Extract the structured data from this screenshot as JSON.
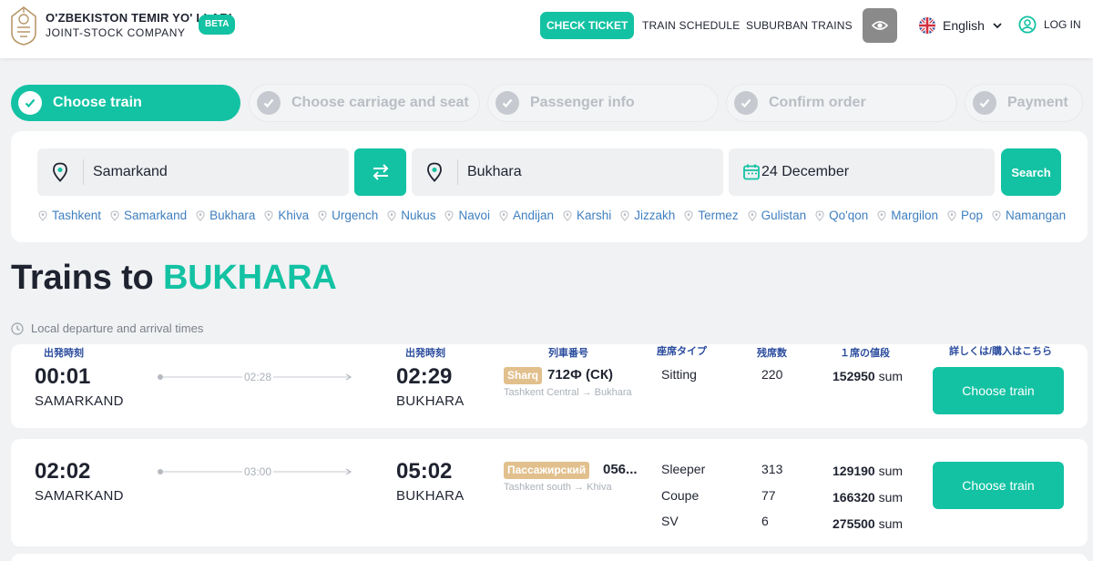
{
  "header": {
    "brand_line1": "O'ZBEKISTON TEMIR YO' LLARI",
    "brand_line2": "JOINT-STOCK COMPANY",
    "beta": "BETA",
    "check_ticket": "CHECK TICKET",
    "train_schedule": "TRAIN SCHEDULE",
    "suburban_trains": "SUBURBAN TRAINS",
    "language": "English",
    "login": "LOG IN"
  },
  "steps": [
    {
      "label": "Choose train",
      "active": true
    },
    {
      "label": "Choose carriage and seat",
      "active": false
    },
    {
      "label": "Passenger info",
      "active": false
    },
    {
      "label": "Confirm order",
      "active": false
    },
    {
      "label": "Payment",
      "active": false
    }
  ],
  "search": {
    "from": "Samarkand",
    "to": "Bukhara",
    "date": "24 December",
    "search_label": "Search",
    "cities": [
      "Tashkent",
      "Samarkand",
      "Bukhara",
      "Khiva",
      "Urgench",
      "Nukus",
      "Navoi",
      "Andijan",
      "Karshi",
      "Jizzakh",
      "Termez",
      "Gulistan",
      "Qo'qon",
      "Margilon",
      "Pop",
      "Namangan"
    ]
  },
  "title": {
    "prefix": "Trains to",
    "destination": "BUKHARA"
  },
  "timezone_note": "Local departure and arrival times",
  "column_labels": {
    "departure": "出発時刻",
    "arrival": "出発時刻",
    "train_number": "列車番号",
    "seat_type": "座席タイプ",
    "seats_left": "残席数",
    "price_per_seat": "１席の値段",
    "details": "詳しくは/購入はこちら"
  },
  "trains": [
    {
      "departure_time": "00:01",
      "departure_station": "SAMARKAND",
      "duration": "02:28",
      "arrival_time": "02:29",
      "arrival_station": "BUKHARA",
      "badge": "Sharq",
      "number": "712Ф (СК)",
      "route": "Tashkent Central → Bukhara",
      "classes": [
        {
          "type": "Sitting",
          "seats": "220",
          "price": "152950",
          "currency": "sum"
        }
      ],
      "button": "Choose train"
    },
    {
      "departure_time": "02:02",
      "departure_station": "SAMARKAND",
      "duration": "03:00",
      "arrival_time": "05:02",
      "arrival_station": "BUKHARA",
      "badge": "Пассажирский",
      "number": "056...",
      "route": "Tashkent south → Khiva",
      "classes": [
        {
          "type": "Sleeper",
          "seats": "313",
          "price": "129190",
          "currency": "sum"
        },
        {
          "type": "Coupe",
          "seats": "77",
          "price": "166320",
          "currency": "sum"
        },
        {
          "type": "SV",
          "seats": "6",
          "price": "275500",
          "currency": "sum"
        }
      ],
      "button": "Choose train"
    }
  ],
  "colors": {
    "accent": "#13c2a3",
    "link": "#3f7fbf",
    "column_label": "#2b4c9e",
    "badge": "#e2c08d"
  }
}
